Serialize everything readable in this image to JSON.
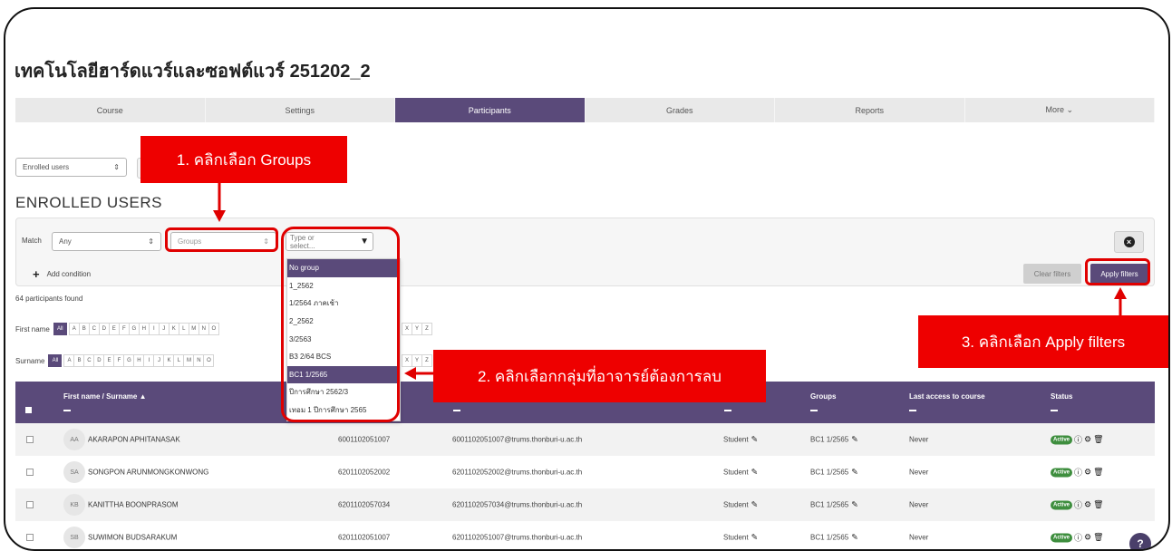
{
  "course": {
    "title": "เทคโนโลยีฮาร์ดแวร์และซอฟต์แวร์ 251202_2"
  },
  "tabs": [
    {
      "label": "Course",
      "active": false
    },
    {
      "label": "Settings",
      "active": false
    },
    {
      "label": "Participants",
      "active": true
    },
    {
      "label": "Grades",
      "active": false
    },
    {
      "label": "Reports",
      "active": false
    },
    {
      "label": "More ⌄",
      "active": false
    }
  ],
  "enrolled_select": {
    "value": "Enrolled users"
  },
  "heading": "ENROLLED USERS",
  "filter": {
    "match_label": "Match",
    "match_value": "Any",
    "type_value": "Groups",
    "value_placeholder": "Type or select...",
    "add_condition": "Add condition",
    "clear_label": "Clear filters",
    "apply_label": "Apply filters"
  },
  "dropdown": {
    "options": [
      "No group",
      "1_2562",
      "1/2564 ภาคเช้า",
      "2_2562",
      "3/2563",
      "B3 2/64 BCS",
      "BC1 1/2565",
      "ปีการศึกษา 2562/3",
      "เทอม 1 ปีการศึกษา 2565"
    ],
    "highlighted": [
      "No group",
      "BC1 1/2565"
    ]
  },
  "participants_found": "64 participants found",
  "initials": {
    "first_label": "First name",
    "surname_label": "Surname",
    "all": "All",
    "first_left": [
      "A",
      "B",
      "C",
      "D",
      "E",
      "F",
      "G",
      "H",
      "I",
      "J",
      "K",
      "L",
      "M",
      "N",
      "O"
    ],
    "first_right": [
      "X",
      "Y",
      "Z"
    ],
    "surname_left": [
      "A",
      "B",
      "C",
      "D",
      "E",
      "F",
      "G",
      "H",
      "I",
      "J",
      "K",
      "L",
      "M",
      "N",
      "O"
    ],
    "surname_right": [
      "X",
      "Y",
      "Z"
    ]
  },
  "table": {
    "headers": {
      "name": "First name / Surname ▲",
      "groups": "Groups",
      "last_access": "Last access to course",
      "status": "Status"
    },
    "rows": [
      {
        "initials": "AA",
        "name": "AKARAPON APHITANASAK",
        "id": "6001102051007",
        "email": "6001102051007@trums.thonburi-u.ac.th",
        "role": "Student",
        "group": "BC1 1/2565",
        "last_access": "Never",
        "status": "Active"
      },
      {
        "initials": "SA",
        "name": "SONGPON ARUNMONGKONWONG",
        "id": "6201102052002",
        "email": "6201102052002@trums.thonburi-u.ac.th",
        "role": "Student",
        "group": "BC1 1/2565",
        "last_access": "Never",
        "status": "Active"
      },
      {
        "initials": "KB",
        "name": "KANITTHA BOONPRASOM",
        "id": "6201102057034",
        "email": "6201102057034@trums.thonburi-u.ac.th",
        "role": "Student",
        "group": "BC1 1/2565",
        "last_access": "Never",
        "status": "Active"
      },
      {
        "initials": "SB",
        "name": "SUWIMON BUDSARAKUM",
        "id": "6201102051007",
        "email": "6201102051007@trums.thonburi-u.ac.th",
        "role": "Student",
        "group": "BC1 1/2565",
        "last_access": "Never",
        "status": "Active"
      }
    ]
  },
  "help": "?",
  "callouts": {
    "step1": "1. คลิกเลือก Groups",
    "step2": "2. คลิกเลือกกลุ่มที่อาจารย์ต้องการลบ",
    "step3": "3. คลิกเลือก Apply filters"
  },
  "colors": {
    "accent": "#5a4a7a",
    "callout": "#ee0000",
    "active_badge": "#3e8e3e"
  }
}
